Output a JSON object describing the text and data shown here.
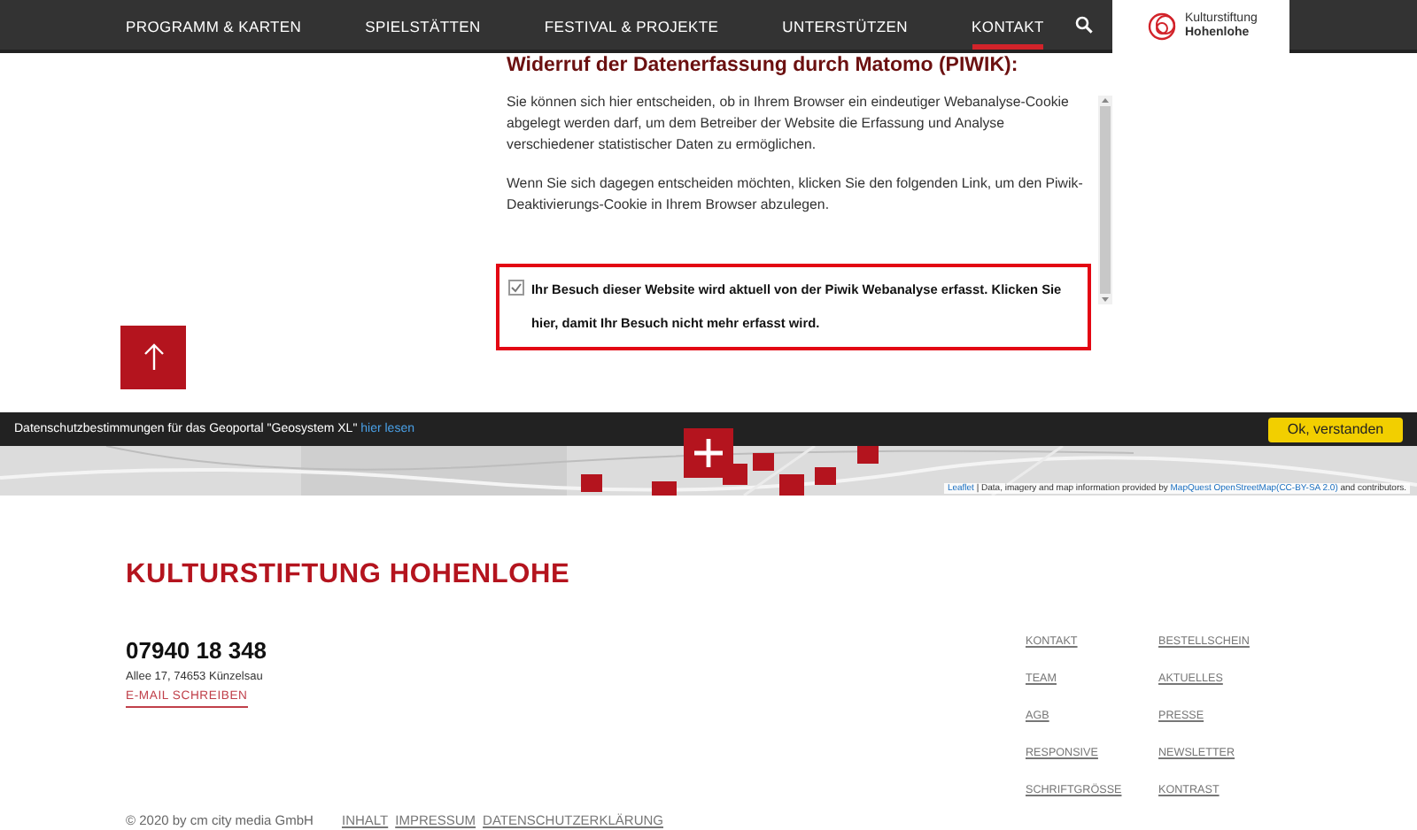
{
  "nav": {
    "items": [
      {
        "label": "PROGRAMM & KARTEN",
        "selected": false
      },
      {
        "label": "SPIELSTÄTTEN",
        "selected": false
      },
      {
        "label": "FESTIVAL & PROJEKTE",
        "selected": false
      },
      {
        "label": "UNTERSTÜTZEN",
        "selected": false
      },
      {
        "label": "KONTAKT",
        "selected": true
      }
    ],
    "logo": {
      "line1": "Kulturstiftung",
      "line2": "Hohenlohe"
    }
  },
  "optout": {
    "heading": "Widerruf der Datenerfassung durch Matomo (PIWIK):",
    "paragraphs": [
      "Sie können sich hier entscheiden, ob in Ihrem Browser ein eindeutiger Webanalyse-Cookie abgelegt werden darf, um dem Betreiber der Website die Erfassung und Analyse verschiedener statistischer Daten zu ermöglichen.",
      "Wenn Sie sich dagegen entscheiden möchten, klicken Sie den folgenden Link, um den Piwik-Deaktivierungs-Cookie in Ihrem Browser abzulegen."
    ],
    "checkbox": {
      "label": "Ihr Besuch dieser Website wird aktuell von der Piwik Webanalyse erfasst. Klicken Sie hier, damit Ihr Besuch nicht mehr erfasst wird.",
      "checked": true
    }
  },
  "cookie_bar": {
    "text": "Datenschutzbestimmungen für das Geoportal \"Geosystem XL\"",
    "link": "hier lesen",
    "button": "Ok, verstanden"
  },
  "map": {
    "attribution": {
      "leaflet": "Leaflet",
      "text": "| Data, imagery and map information provided by",
      "mapquest": "MapQuest",
      "osm": "OpenStreetMap(CC-BY-SA 2.0)",
      "end": "and contributors."
    }
  },
  "footer": {
    "title": "KULTURSTIFTUNG HOHENLOHE",
    "phone": "07940 18 348",
    "address": "Allee 17, 74653 Künzelsau",
    "email": "E-MAIL SCHREIBEN",
    "copyright": "© 2020 by cm city media GmbH",
    "bottom_links": [
      "INHALT",
      "IMPRESSUM",
      "DATENSCHUTZERKLÄRUNG"
    ],
    "link_columns": [
      [
        "KONTAKT",
        "TEAM",
        "AGB",
        "RESPONSIVE",
        "SCHRIFTGRÖSSE"
      ],
      [
        "BESTELLSCHEIN",
        "AKTUELLES",
        "PRESSE",
        "NEWSLETTER",
        "KONTRAST"
      ]
    ]
  }
}
